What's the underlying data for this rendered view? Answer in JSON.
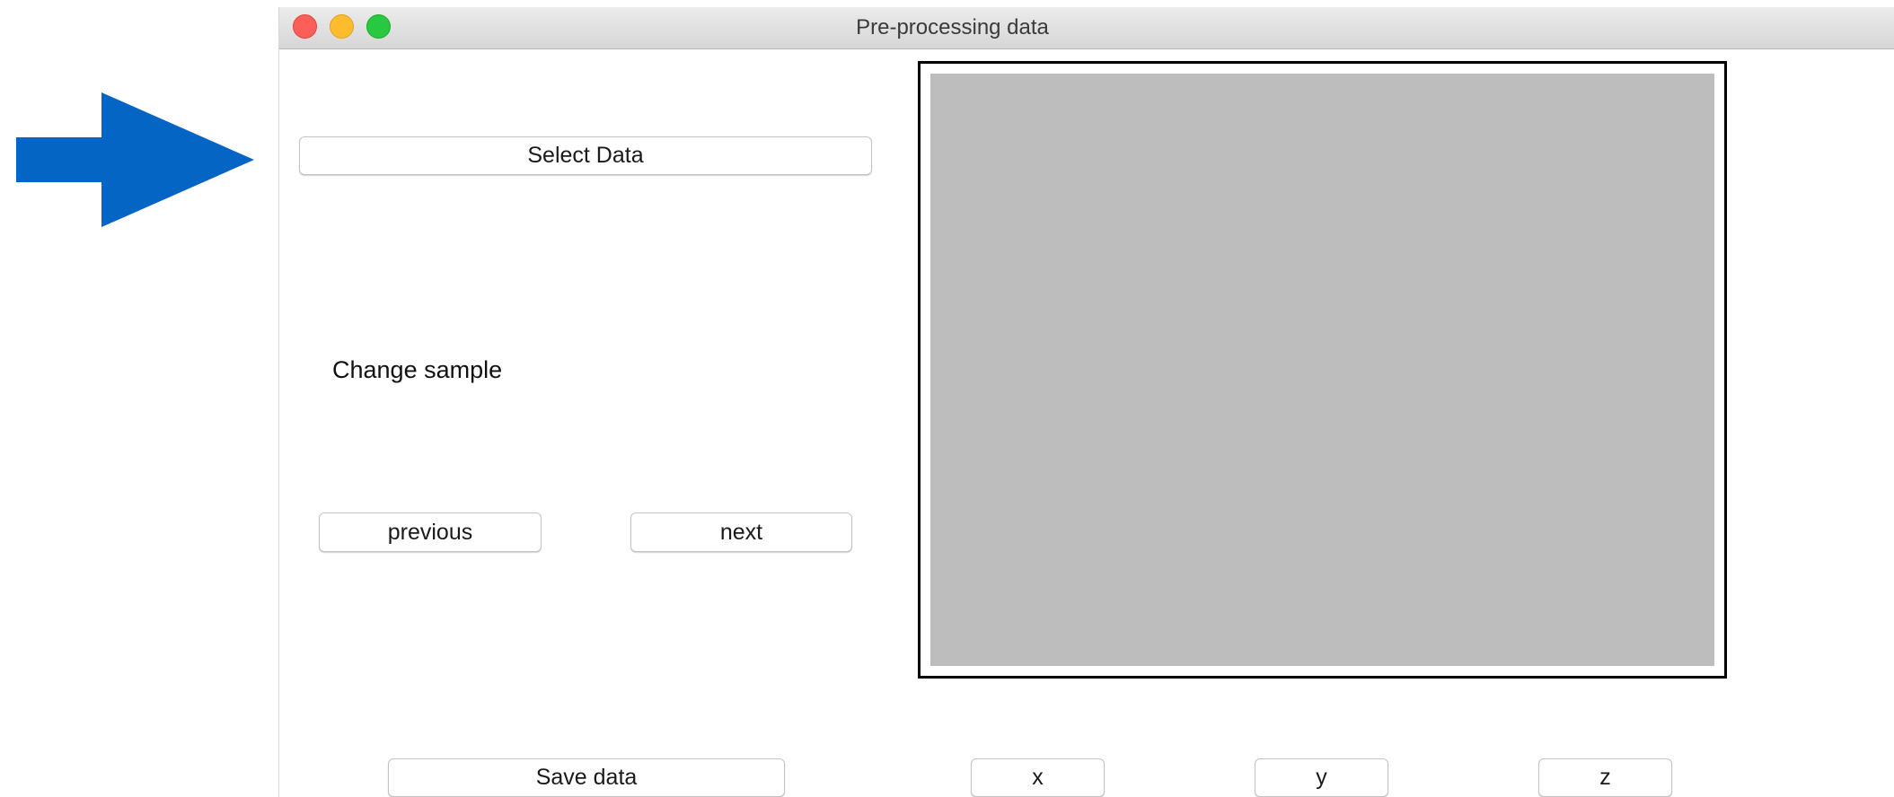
{
  "window": {
    "title": "Pre-processing data"
  },
  "annotation": {
    "arrow_icon": "right-arrow-icon",
    "arrow_color": "#0565c4"
  },
  "controls": {
    "select_data_label": "Select Data",
    "change_sample_label": "Change sample",
    "previous_label": "previous",
    "next_label": "next",
    "save_data_label": "Save data",
    "x_label": "x",
    "y_label": "y",
    "z_label": "z"
  },
  "colors": {
    "close": "#fc5f57",
    "minimize": "#fdbc2e",
    "maximize": "#28c840",
    "canvas_fill": "#bdbdbd"
  }
}
